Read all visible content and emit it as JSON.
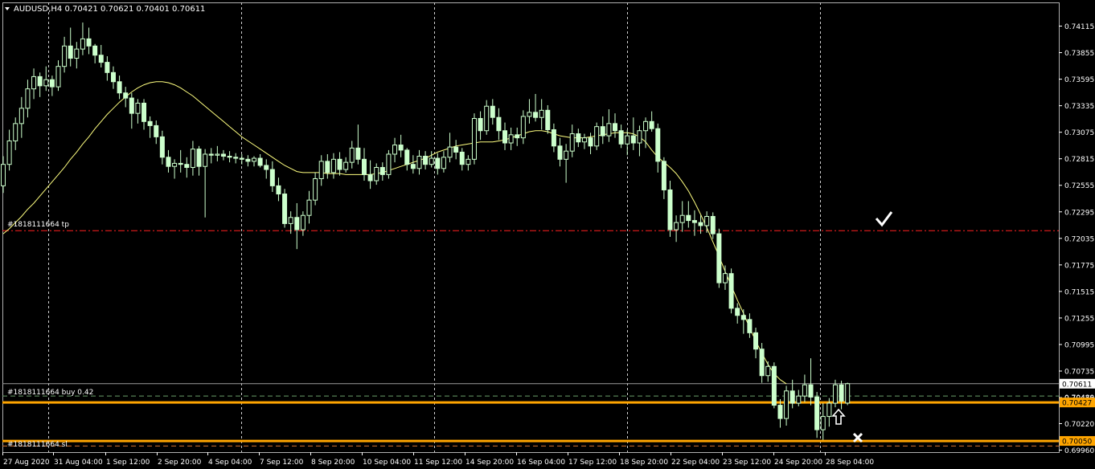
{
  "header": {
    "symbol_label": "AUDUSD,H4  0.70421 0.70621 0.70401 0.70611"
  },
  "colors": {
    "background": "#000000",
    "grid": "#c8c8c8",
    "candle_up": "#ccffcc",
    "candle_down": "#ccffcc",
    "wick": "#ccffcc",
    "moving_average": "#ffff80",
    "tp_line": "#ff2020",
    "order_line": "#ffa500",
    "axis_text": "#ffffff"
  },
  "annotations": {
    "tp_label": "#1818111664 tp",
    "buy_label": "#1818111664 buy 0.42",
    "sl_label": "#1818111664 sl",
    "check_icon": "check-mark",
    "arrow_icon": "up-arrow",
    "cross_icon": "x-mark"
  },
  "chart_data": {
    "type": "candlestick",
    "symbol": "AUDUSD",
    "timeframe": "H4",
    "ylim": [
      0.6996,
      0.7424
    ],
    "y_ticks": [
      "0.74115",
      "0.73855",
      "0.73595",
      "0.73335",
      "0.73075",
      "0.72815",
      "0.72555",
      "0.72295",
      "0.72035",
      "0.71775",
      "0.71515",
      "0.71255",
      "0.70995",
      "0.70735",
      "0.70475",
      "0.70220",
      "0.69960"
    ],
    "x_ticks": [
      "27 Aug 2020",
      "31 Aug 04:00",
      "1 Sep 12:00",
      "2 Sep 20:00",
      "4 Sep 04:00",
      "7 Sep 12:00",
      "8 Sep 20:00",
      "10 Sep 04:00",
      "11 Sep 12:00",
      "14 Sep 20:00",
      "16 Sep 04:00",
      "17 Sep 12:00",
      "18 Sep 20:00",
      "22 Sep 04:00",
      "23 Sep 12:00",
      "24 Sep 20:00",
      "28 Sep 04:00"
    ],
    "current_price": "0.70611",
    "current_price_value": 0.70611,
    "levels": {
      "tp": 0.7211,
      "open": {
        "value": 0.70427,
        "label": "0.70427"
      },
      "open_dashed": 0.7049,
      "sl": {
        "value": 0.7005,
        "label": "0.70050"
      },
      "sl_dashed": 0.7,
      "last": 0.70611
    },
    "axis_partial_label": "0.70480",
    "candles": [
      [
        0.7255,
        0.7284,
        0.7248,
        0.7276
      ],
      [
        0.7276,
        0.731,
        0.727,
        0.7299
      ],
      [
        0.7299,
        0.7322,
        0.729,
        0.7316
      ],
      [
        0.7316,
        0.7342,
        0.7302,
        0.7331
      ],
      [
        0.7331,
        0.7359,
        0.7322,
        0.735
      ],
      [
        0.735,
        0.737,
        0.734,
        0.7362
      ],
      [
        0.7362,
        0.7366,
        0.7342,
        0.7353
      ],
      [
        0.7353,
        0.7372,
        0.7348,
        0.7359
      ],
      [
        0.7359,
        0.7363,
        0.7343,
        0.7352
      ],
      [
        0.7352,
        0.7378,
        0.7348,
        0.7372
      ],
      [
        0.7372,
        0.7401,
        0.7366,
        0.7392
      ],
      [
        0.7392,
        0.741,
        0.7372,
        0.738
      ],
      [
        0.738,
        0.7396,
        0.737,
        0.7389
      ],
      [
        0.7389,
        0.7415,
        0.7383,
        0.7399
      ],
      [
        0.7399,
        0.741,
        0.7384,
        0.7392
      ],
      [
        0.7392,
        0.7394,
        0.7375,
        0.7383
      ],
      [
        0.7383,
        0.7393,
        0.7371,
        0.7376
      ],
      [
        0.7376,
        0.7382,
        0.7358,
        0.7366
      ],
      [
        0.7366,
        0.7372,
        0.735,
        0.7357
      ],
      [
        0.7357,
        0.7363,
        0.734,
        0.7346
      ],
      [
        0.7346,
        0.7352,
        0.7332,
        0.7341
      ],
      [
        0.7341,
        0.7346,
        0.7311,
        0.7326
      ],
      [
        0.7326,
        0.734,
        0.7316,
        0.7336
      ],
      [
        0.7336,
        0.734,
        0.731,
        0.7318
      ],
      [
        0.7318,
        0.7323,
        0.7302,
        0.7314
      ],
      [
        0.7314,
        0.7319,
        0.7296,
        0.7303
      ],
      [
        0.7303,
        0.7309,
        0.7276,
        0.7283
      ],
      [
        0.7283,
        0.729,
        0.7268,
        0.7274
      ],
      [
        0.7274,
        0.7281,
        0.7262,
        0.7277
      ],
      [
        0.7277,
        0.729,
        0.7268,
        0.7276
      ],
      [
        0.7276,
        0.7283,
        0.7263,
        0.7273
      ],
      [
        0.7273,
        0.7299,
        0.7265,
        0.7291
      ],
      [
        0.7291,
        0.7294,
        0.7265,
        0.7274
      ],
      [
        0.7274,
        0.7291,
        0.7224,
        0.7286
      ],
      [
        0.7286,
        0.7292,
        0.7277,
        0.7285
      ],
      [
        0.7285,
        0.7294,
        0.7279,
        0.7286
      ],
      [
        0.7286,
        0.729,
        0.728,
        0.7284
      ],
      [
        0.7284,
        0.7289,
        0.7278,
        0.7283
      ],
      [
        0.7283,
        0.7287,
        0.7277,
        0.7282
      ],
      [
        0.7282,
        0.7286,
        0.7276,
        0.7281
      ],
      [
        0.7281,
        0.7285,
        0.7274,
        0.7279
      ],
      [
        0.7279,
        0.7284,
        0.7274,
        0.7282
      ],
      [
        0.7282,
        0.7286,
        0.7273,
        0.7275
      ],
      [
        0.7275,
        0.7281,
        0.7262,
        0.7271
      ],
      [
        0.7271,
        0.7279,
        0.7249,
        0.7255
      ],
      [
        0.7255,
        0.7263,
        0.724,
        0.7247
      ],
      [
        0.7247,
        0.7252,
        0.7214,
        0.7218
      ],
      [
        0.7218,
        0.723,
        0.7208,
        0.7224
      ],
      [
        0.7224,
        0.7238,
        0.7193,
        0.7212
      ],
      [
        0.7212,
        0.723,
        0.7206,
        0.7226
      ],
      [
        0.7226,
        0.725,
        0.7218,
        0.7241
      ],
      [
        0.7241,
        0.7268,
        0.7236,
        0.7262
      ],
      [
        0.7262,
        0.7285,
        0.7255,
        0.7279
      ],
      [
        0.7279,
        0.7286,
        0.7262,
        0.7268
      ],
      [
        0.7268,
        0.7287,
        0.7262,
        0.7281
      ],
      [
        0.7281,
        0.7288,
        0.7265,
        0.7271
      ],
      [
        0.7271,
        0.7283,
        0.7268,
        0.7278
      ],
      [
        0.7278,
        0.7299,
        0.7272,
        0.7292
      ],
      [
        0.7292,
        0.7315,
        0.7276,
        0.7281
      ],
      [
        0.7281,
        0.7292,
        0.726,
        0.7266
      ],
      [
        0.7266,
        0.728,
        0.7252,
        0.726
      ],
      [
        0.726,
        0.7277,
        0.7256,
        0.7273
      ],
      [
        0.7273,
        0.7278,
        0.726,
        0.7266
      ],
      [
        0.7266,
        0.729,
        0.7262,
        0.7286
      ],
      [
        0.7286,
        0.7302,
        0.7278,
        0.7295
      ],
      [
        0.7295,
        0.7305,
        0.7283,
        0.729
      ],
      [
        0.729,
        0.7292,
        0.727,
        0.7276
      ],
      [
        0.7276,
        0.7285,
        0.7267,
        0.7272
      ],
      [
        0.7272,
        0.729,
        0.7266,
        0.7284
      ],
      [
        0.7284,
        0.7289,
        0.7271,
        0.7276
      ],
      [
        0.7276,
        0.7289,
        0.7273,
        0.7282
      ],
      [
        0.7282,
        0.7287,
        0.7266,
        0.7272
      ],
      [
        0.7272,
        0.7289,
        0.7268,
        0.7283
      ],
      [
        0.7283,
        0.7307,
        0.7278,
        0.7293
      ],
      [
        0.7293,
        0.73,
        0.7281,
        0.7288
      ],
      [
        0.7288,
        0.7292,
        0.727,
        0.7276
      ],
      [
        0.7276,
        0.7285,
        0.727,
        0.7281
      ],
      [
        0.7281,
        0.7326,
        0.7276,
        0.7321
      ],
      [
        0.7321,
        0.7328,
        0.73,
        0.7309
      ],
      [
        0.7309,
        0.7339,
        0.7305,
        0.7333
      ],
      [
        0.7333,
        0.734,
        0.7315,
        0.7322
      ],
      [
        0.7322,
        0.7331,
        0.73,
        0.7309
      ],
      [
        0.7309,
        0.7317,
        0.729,
        0.7297
      ],
      [
        0.7297,
        0.7312,
        0.729,
        0.7305
      ],
      [
        0.7305,
        0.7312,
        0.7294,
        0.7302
      ],
      [
        0.7302,
        0.7329,
        0.7296,
        0.7323
      ],
      [
        0.7323,
        0.734,
        0.7316,
        0.7327
      ],
      [
        0.7327,
        0.7345,
        0.7318,
        0.7322
      ],
      [
        0.7322,
        0.734,
        0.731,
        0.7329
      ],
      [
        0.7329,
        0.7334,
        0.7306,
        0.731
      ],
      [
        0.731,
        0.7316,
        0.7288,
        0.7294
      ],
      [
        0.7294,
        0.7302,
        0.7274,
        0.7281
      ],
      [
        0.7281,
        0.7296,
        0.7258,
        0.7289
      ],
      [
        0.7289,
        0.7315,
        0.7283,
        0.7306
      ],
      [
        0.7306,
        0.7311,
        0.7293,
        0.7298
      ],
      [
        0.7298,
        0.7306,
        0.7291,
        0.7302
      ],
      [
        0.7302,
        0.7307,
        0.7286,
        0.7294
      ],
      [
        0.7294,
        0.7317,
        0.729,
        0.7313
      ],
      [
        0.7313,
        0.7323,
        0.7296,
        0.7304
      ],
      [
        0.7304,
        0.733,
        0.7298,
        0.7316
      ],
      [
        0.7316,
        0.7326,
        0.7302,
        0.7309
      ],
      [
        0.7309,
        0.7315,
        0.7292,
        0.7296
      ],
      [
        0.7296,
        0.731,
        0.7285,
        0.7304
      ],
      [
        0.7304,
        0.7322,
        0.729,
        0.7297
      ],
      [
        0.7297,
        0.7314,
        0.7284,
        0.7309
      ],
      [
        0.7309,
        0.7322,
        0.7292,
        0.7318
      ],
      [
        0.7318,
        0.7328,
        0.7308,
        0.7311
      ],
      [
        0.7311,
        0.7316,
        0.7268,
        0.7279
      ],
      [
        0.7279,
        0.7283,
        0.7242,
        0.7251
      ],
      [
        0.7251,
        0.726,
        0.7205,
        0.7212
      ],
      [
        0.7212,
        0.7226,
        0.72,
        0.7219
      ],
      [
        0.7219,
        0.724,
        0.721,
        0.7226
      ],
      [
        0.7226,
        0.724,
        0.7214,
        0.7221
      ],
      [
        0.7221,
        0.7231,
        0.7206,
        0.7219
      ],
      [
        0.7219,
        0.7226,
        0.7208,
        0.7216
      ],
      [
        0.7216,
        0.723,
        0.7209,
        0.7225
      ],
      [
        0.7225,
        0.7229,
        0.7203,
        0.7208
      ],
      [
        0.7208,
        0.7213,
        0.7155,
        0.716
      ],
      [
        0.716,
        0.7177,
        0.7153,
        0.7169
      ],
      [
        0.7169,
        0.7174,
        0.713,
        0.7135
      ],
      [
        0.7135,
        0.714,
        0.712,
        0.7128
      ],
      [
        0.7128,
        0.7134,
        0.711,
        0.7124
      ],
      [
        0.7124,
        0.713,
        0.7106,
        0.7111
      ],
      [
        0.7111,
        0.7116,
        0.7086,
        0.7095
      ],
      [
        0.7095,
        0.7101,
        0.7062,
        0.7069
      ],
      [
        0.7069,
        0.7083,
        0.7063,
        0.7078
      ],
      [
        0.7078,
        0.7082,
        0.7037,
        0.704
      ],
      [
        0.704,
        0.7046,
        0.7018,
        0.7027
      ],
      [
        0.7027,
        0.7059,
        0.702,
        0.7054
      ],
      [
        0.7054,
        0.7065,
        0.7037,
        0.7042
      ],
      [
        0.7042,
        0.7055,
        0.7039,
        0.7049
      ],
      [
        0.7049,
        0.707,
        0.7043,
        0.706
      ],
      [
        0.706,
        0.7086,
        0.704,
        0.7048
      ],
      [
        0.7048,
        0.7053,
        0.7008,
        0.7016
      ],
      [
        0.7016,
        0.7042,
        0.7006,
        0.7029
      ],
      [
        0.7029,
        0.7047,
        0.7019,
        0.7042
      ],
      [
        0.7042,
        0.7065,
        0.7038,
        0.706
      ],
      [
        0.706,
        0.7064,
        0.7036,
        0.7044
      ],
      [
        0.70421,
        0.70621,
        0.70401,
        0.70611
      ]
    ],
    "moving_average": [
      0.7208,
      0.7213,
      0.7219,
      0.7225,
      0.7232,
      0.7238,
      0.7245,
      0.7252,
      0.7259,
      0.7266,
      0.7273,
      0.7281,
      0.7288,
      0.7296,
      0.7303,
      0.7311,
      0.7318,
      0.7325,
      0.7331,
      0.7337,
      0.7342,
      0.7347,
      0.7351,
      0.7354,
      0.7356,
      0.7357,
      0.7357,
      0.7356,
      0.7354,
      0.7351,
      0.7347,
      0.7343,
      0.7338,
      0.7333,
      0.7328,
      0.7323,
      0.7318,
      0.7313,
      0.7308,
      0.7303,
      0.7299,
      0.7295,
      0.7291,
      0.7287,
      0.7283,
      0.7279,
      0.7275,
      0.7272,
      0.7269,
      0.7268,
      0.7268,
      0.7268,
      0.7268,
      0.7267,
      0.7267,
      0.7267,
      0.7266,
      0.7266,
      0.7266,
      0.7266,
      0.7266,
      0.7267,
      0.7268,
      0.727,
      0.7272,
      0.7274,
      0.7276,
      0.7278,
      0.728,
      0.7282,
      0.7285,
      0.7288,
      0.729,
      0.7292,
      0.7294,
      0.7295,
      0.7296,
      0.7297,
      0.7298,
      0.7298,
      0.7298,
      0.7299,
      0.73,
      0.7302,
      0.7304,
      0.7306,
      0.7308,
      0.7309,
      0.7309,
      0.7308,
      0.7306,
      0.7304,
      0.7303,
      0.7302,
      0.7302,
      0.7302,
      0.7303,
      0.7304,
      0.7305,
      0.7306,
      0.7307,
      0.7307,
      0.7307,
      0.7306,
      0.7303,
      0.7298,
      0.729,
      0.7283,
      0.7278,
      0.7273,
      0.7267,
      0.7259,
      0.725,
      0.7239,
      0.7227,
      0.7214,
      0.72,
      0.7186,
      0.7171,
      0.7157,
      0.7143,
      0.713,
      0.7116,
      0.7103,
      0.7091,
      0.708,
      0.7071,
      0.7065,
      0.7061
    ]
  }
}
